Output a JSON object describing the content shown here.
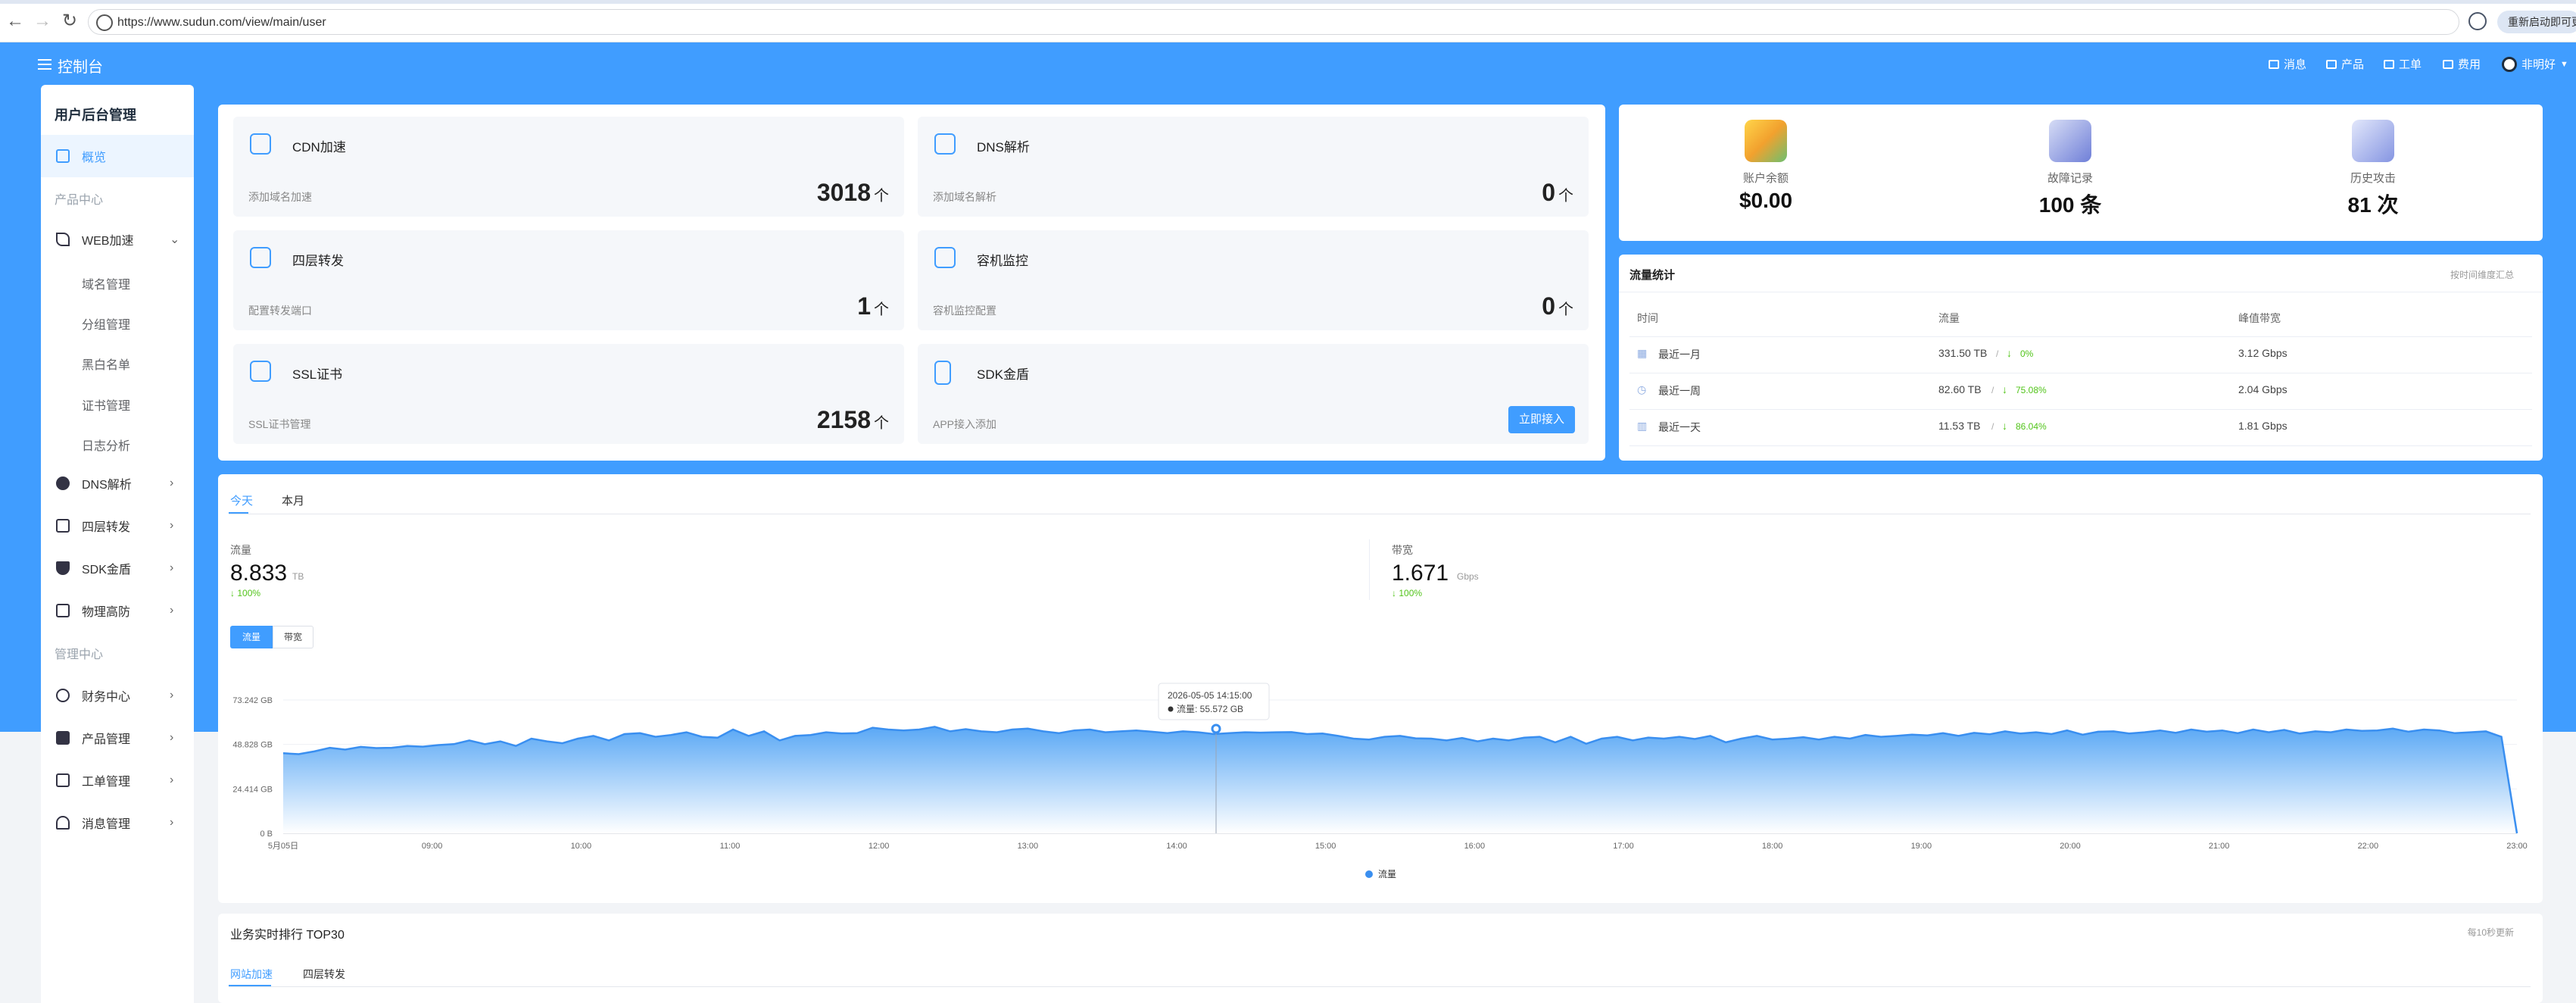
{
  "browser": {
    "url": "https://www.sudun.com/view/main/user",
    "restart_label": "重新启动即可更新"
  },
  "header": {
    "title": "控制台",
    "nav": [
      {
        "label": "消息",
        "icon": "mail-icon"
      },
      {
        "label": "产品",
        "icon": "box-icon"
      },
      {
        "label": "工单",
        "icon": "ticket-icon"
      },
      {
        "label": "费用",
        "icon": "folder-icon"
      }
    ],
    "user_label": "非明好"
  },
  "sidebar": {
    "title": "用户后台管理",
    "overview": "概览",
    "section_product": "产品中心",
    "web": "WEB加速",
    "web_sub": [
      "域名管理",
      "分组管理",
      "黑白名单",
      "证书管理",
      "日志分析"
    ],
    "dns": "DNS解析",
    "l4": "四层转发",
    "sdk": "SDK金盾",
    "phys": "物理高防",
    "section_manage": "管理中心",
    "finance": "财务中心",
    "products": "产品管理",
    "tickets": "工单管理",
    "messages": "消息管理"
  },
  "features": [
    {
      "name": "CDN加速",
      "sub": "添加域名加速",
      "value": "3018",
      "unit": "个",
      "icon": "cloud-icon"
    },
    {
      "name": "DNS解析",
      "sub": "添加域名解析",
      "value": "0",
      "unit": "个",
      "icon": "link-icon"
    },
    {
      "name": "四层转发",
      "sub": "配置转发端口",
      "value": "1",
      "unit": "个",
      "icon": "chip-icon"
    },
    {
      "name": "容机监控",
      "sub": "容机监控配置",
      "value": "0",
      "unit": "个",
      "icon": "monitor-icon"
    },
    {
      "name": "SSL证书",
      "sub": "SSL证书管理",
      "value": "2158",
      "unit": "个",
      "icon": "certificate-icon"
    },
    {
      "name": "SDK金盾",
      "sub": "APP接入添加",
      "button": "立即接入",
      "icon": "phone-icon"
    }
  ],
  "summary": [
    {
      "label": "账户余额",
      "value": "$0.00"
    },
    {
      "label": "故障记录",
      "value": "100 条"
    },
    {
      "label": "历史攻击",
      "value": "81 次"
    }
  ],
  "traffic_stats": {
    "title": "流量统计",
    "note": "按时间维度汇总",
    "headers": [
      "时间",
      "流量",
      "峰值带宽"
    ],
    "rows": [
      {
        "time": "最近一月",
        "flow": "331.50 TB",
        "pct": "0%",
        "peak": "3.12 Gbps"
      },
      {
        "time": "最近一周",
        "flow": "82.60 TB",
        "pct": "75.08%",
        "peak": "2.04 Gbps"
      },
      {
        "time": "最近一天",
        "flow": "11.53 TB",
        "pct": "86.04%",
        "peak": "1.81 Gbps"
      }
    ]
  },
  "chart_section": {
    "tabs": [
      "今天",
      "本月"
    ],
    "flow_label": "流量",
    "flow_value": "8.833",
    "flow_unit": "TB",
    "flow_change": "100%",
    "bw_label": "带宽",
    "bw_value": "1.671",
    "bw_unit": "Gbps",
    "bw_change": "100%",
    "toggle": [
      "流量",
      "带宽"
    ],
    "tooltip_time": "2026-05-05 14:15:00",
    "tooltip_value": "流量: 55.572 GB",
    "legend": "流量"
  },
  "chart_data": {
    "type": "area",
    "y_ticks": [
      "73.242 GB",
      "48.828 GB",
      "24.414 GB",
      "0 B"
    ],
    "ylim": [
      0,
      73.242
    ],
    "x_ticks": [
      "5月05日",
      "09:00",
      "10:00",
      "11:00",
      "12:00",
      "13:00",
      "14:00",
      "15:00",
      "16:00",
      "17:00",
      "18:00",
      "19:00",
      "20:00",
      "21:00",
      "22:00",
      "23:00"
    ],
    "series": [
      {
        "name": "流量",
        "x_start_hour": 8,
        "x_end_hour": 23,
        "values": [
          44,
          43.5,
          45,
          47,
          46,
          47.5,
          46.8,
          47,
          48,
          47.6,
          48.5,
          49,
          51,
          49,
          50.5,
          48,
          52,
          50.5,
          49.5,
          52,
          53.5,
          51,
          54.5,
          55,
          53,
          54,
          55.5,
          53,
          52.5,
          57,
          53.5,
          56,
          51,
          53.5,
          54,
          55.5,
          54.8,
          55,
          58,
          57,
          56.5,
          57,
          58.5,
          56,
          57.2,
          56,
          55.5,
          57,
          57.5,
          56,
          55,
          56.5,
          57,
          55.5,
          56,
          56.5,
          55.8,
          55,
          56,
          55.5,
          54.5,
          55,
          55.5,
          55.3,
          55.5,
          55.6,
          54.5,
          54.8,
          53.5,
          52,
          51.5,
          53,
          53.5,
          52.2,
          52,
          51,
          52.4,
          50.5,
          52,
          51,
          52.5,
          53,
          50,
          53,
          49.2,
          52,
          53,
          51,
          52.6,
          52,
          53,
          51.8,
          53.5,
          50,
          52,
          53.5,
          51.5,
          52,
          52.8,
          51.5,
          53,
          52,
          54,
          53,
          53.5,
          54.2,
          53.8,
          55,
          53.5,
          55.2,
          54.4,
          56,
          54.8,
          55.5,
          54.5,
          56.5,
          54.2,
          55.8,
          56,
          54.8,
          55.5,
          56.5,
          55.2,
          57,
          55.8,
          56.5,
          55,
          57,
          55.5,
          56.8,
          54.8,
          56,
          55.5,
          57,
          56.3,
          56.5,
          57.5,
          55.8,
          57,
          56.5,
          55,
          55.5,
          56,
          53,
          0
        ]
      }
    ]
  },
  "ranking": {
    "title": "业务实时排行 TOP30",
    "note": "每10秒更新",
    "tabs": [
      "网站加速",
      "四层转发"
    ]
  },
  "colors": {
    "primary": "#409dff",
    "up": "#52c41a"
  }
}
